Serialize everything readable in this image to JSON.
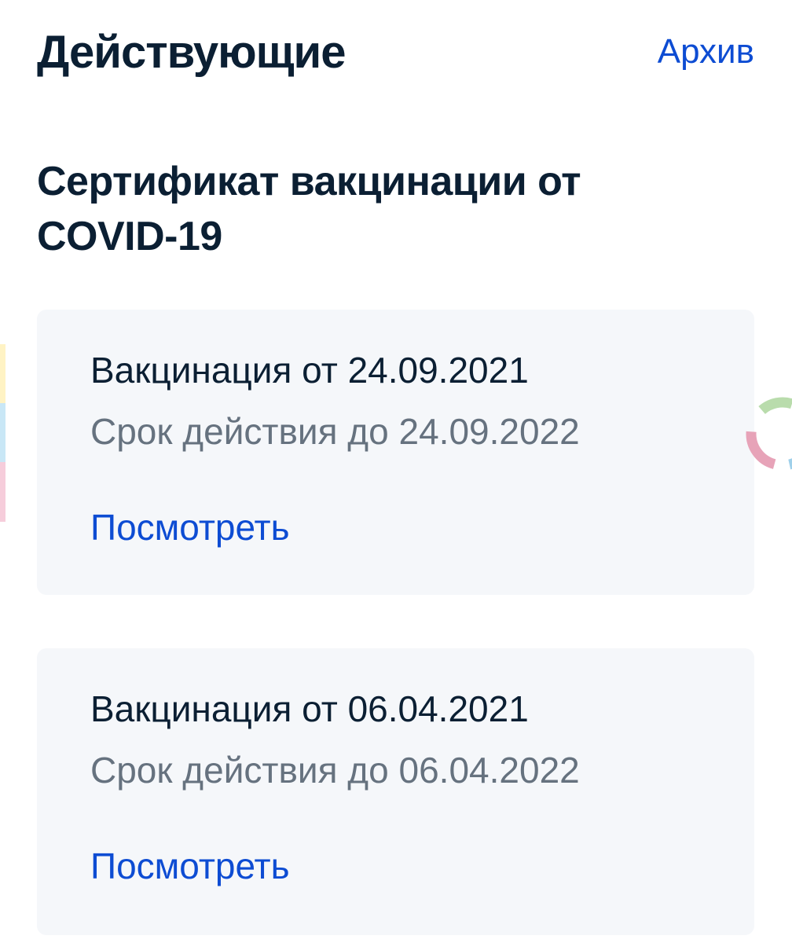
{
  "header": {
    "title": "Действующие",
    "archive_label": "Архив"
  },
  "section": {
    "title_line1": "Сертификат вакцинации от",
    "title_line2": "COVID-19"
  },
  "certificates": [
    {
      "title": "Вакцинация от 24.09.2021",
      "validity": "Срок действия до 24.09.2022",
      "action_label": "Посмотреть"
    },
    {
      "title": "Вакцинация от 06.04.2021",
      "validity": "Срок действия до 06.04.2022",
      "action_label": "Посмотреть"
    }
  ],
  "colors": {
    "text_primary": "#0b1f33",
    "text_secondary": "#66727f",
    "link": "#0d4cd3",
    "card_background": "#f5f7fa"
  },
  "icons": {
    "loader": "loader-ring-icon"
  }
}
